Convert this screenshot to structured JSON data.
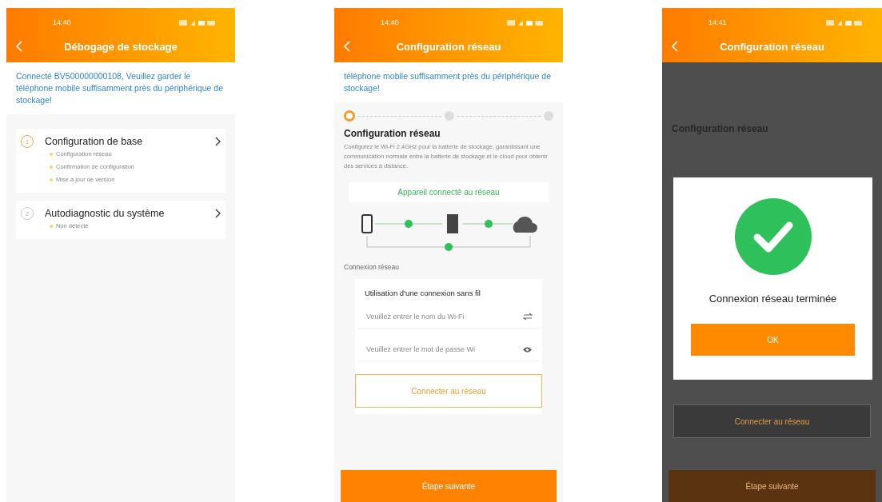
{
  "screens": [
    {
      "kind": "debug",
      "time": "14:40",
      "title": "Débogage de stockage",
      "notice": "Connecté BV500000000108, Veuillez garder le téléphone mobile suffisamment près du périphérique de stockage!",
      "items": [
        {
          "number": "1",
          "selected": true,
          "title": "Configuration de base",
          "subitems": [
            "Configuration réseau",
            "Confirmation de configuration",
            "Mise à jour de version"
          ]
        },
        {
          "number": "2",
          "selected": false,
          "title": "Autodiagnostic du système",
          "subitems": [
            "Non détecté"
          ]
        }
      ]
    },
    {
      "kind": "network",
      "time": "14:40",
      "title": "Configuration réseau",
      "notice": "téléphone mobile suffisamment près du périphérique de stockage!",
      "steps": [
        {
          "selected": true
        },
        {
          "selected": false
        },
        {
          "selected": false
        }
      ],
      "heading": "Configuration réseau",
      "description": "Configurez le Wi-Fi 2.4GHz pour la batterie de stockage, garantissant une communication normale entre la batterie de stockage et le cloud pour obtenir des services à distance.",
      "status": "Appareil connecté au réseau",
      "section": "Connexion réseau",
      "card_title": "Utilisation d'une connexion sans fil",
      "wifi_placeholder": "Veuillez entrer le nom du Wi-Fi",
      "password_placeholder": "Veuillez entrer le mot de passe Wi",
      "connect_button": "Connecter au réseau",
      "next_button": "Étape suivante"
    },
    {
      "kind": "dialog",
      "time": "14:41",
      "title": "Configuration réseau",
      "heading": "Configuration réseau",
      "connect_button": "Connecter au réseau",
      "next_button": "Étape suivante",
      "dialog": {
        "message": "Connexion réseau terminée",
        "button": "OK"
      }
    }
  ]
}
